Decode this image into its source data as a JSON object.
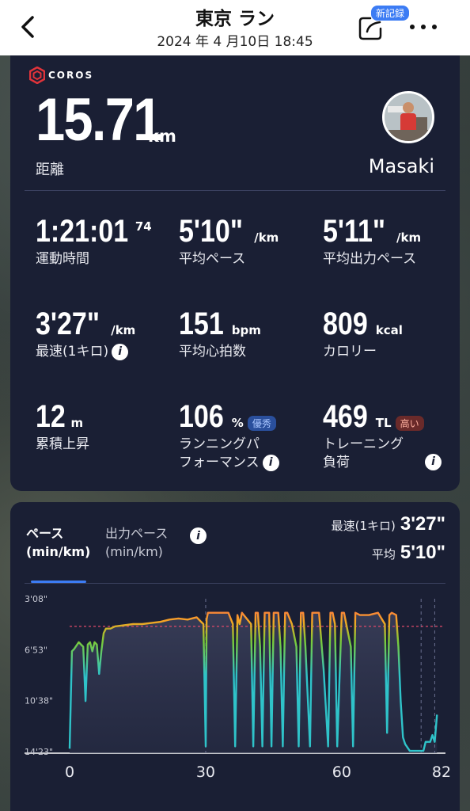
{
  "header": {
    "title": "東京 ラン",
    "datetime": "2024 年 4 月10日 18:45",
    "new_record_badge": "新記録"
  },
  "summary": {
    "brand": "COROS",
    "distance_value": "15.71",
    "distance_unit": "km",
    "distance_label": "距離",
    "user_name": "Masaki"
  },
  "stats": [
    {
      "value": "1:21:01",
      "suffix": "74",
      "unit": "",
      "label": "運動時間"
    },
    {
      "value": "5'10\"",
      "unit": "/km",
      "label": "平均ペース"
    },
    {
      "value": "5'11\"",
      "unit": "/km",
      "label": "平均出力ペース"
    },
    {
      "value": "3'27\"",
      "unit": "/km",
      "label": "最速(1キロ)"
    },
    {
      "value": "151",
      "unit": "bpm",
      "label": "平均心拍数"
    },
    {
      "value": "809",
      "unit": "kcal",
      "label": "カロリー"
    },
    {
      "value": "12",
      "unit": "m",
      "label": "累積上昇"
    },
    {
      "value": "106",
      "unit": "%",
      "badge": "優秀",
      "label": "ランニングパフォーマンス",
      "label_l1": "ランニングパ",
      "label_l2": "フォーマンス"
    },
    {
      "value": "469",
      "unit": "TL",
      "badge": "高い",
      "label_l1": "トレーニング",
      "label_l2": "負荷"
    }
  ],
  "chart_panel": {
    "tab_pace_l1": "ペース",
    "tab_pace_l2": "(min/km)",
    "tab_power_l1": "出力ペース",
    "tab_power_l2": "(min/km)",
    "fastest_label": "最速(1キロ)",
    "fastest_value": "3'27\"",
    "avg_label": "平均",
    "avg_value": "5'10\""
  },
  "colors": {
    "card_bg": "#1a1f34",
    "accent_blue": "#3c7cf4",
    "pace_slow": "#2fc3c9",
    "pace_mid": "#7acb3a",
    "pace_fast": "#ff5a55",
    "avg_line": "#e0486a"
  },
  "chart_data": {
    "type": "line",
    "title": "",
    "xlabel": "",
    "ylabel": "",
    "y_tick_labels": [
      "3'08\"",
      "6'53\"",
      "10'38\"",
      "14'23\""
    ],
    "y_ticks_sec": [
      188,
      413,
      638,
      863
    ],
    "x_tick_labels": [
      "0",
      "30",
      "60",
      "82"
    ],
    "x_ticks": [
      0,
      30,
      60,
      82
    ],
    "xlim": [
      0,
      82
    ],
    "ylim_sec": [
      188,
      863
    ],
    "y_inverted": true,
    "avg_line_sec": 310,
    "vertical_markers_x": [
      30,
      77.5,
      80.5
    ],
    "x": [
      0,
      0.5,
      1,
      2,
      3,
      3.5,
      4,
      4.5,
      5,
      5.5,
      6,
      6.5,
      7,
      7.5,
      8,
      9,
      10,
      12,
      14,
      16,
      18,
      20,
      22,
      24,
      26,
      28,
      29.5,
      30,
      30.2,
      30.5,
      31,
      33,
      35,
      36,
      36.5,
      37,
      37.5,
      38,
      40,
      40.5,
      41,
      41.5,
      42,
      42.5,
      43,
      44,
      44.5,
      45,
      46,
      46.5,
      47,
      47.5,
      48,
      49,
      50,
      50.5,
      51,
      51.5,
      52,
      53,
      53.5,
      54,
      55,
      56,
      57,
      57.5,
      58,
      58.5,
      59,
      60,
      60.5,
      61,
      62,
      62.5,
      63,
      64,
      66,
      68,
      69.5,
      70,
      70.5,
      71,
      72,
      72.5,
      73,
      73.5,
      74,
      75,
      76,
      76.5,
      77,
      77.5,
      78,
      78.5,
      79.5,
      80,
      80.5,
      81
    ],
    "y_sec": [
      850,
      420,
      410,
      380,
      400,
      640,
      390,
      380,
      420,
      380,
      390,
      520,
      420,
      340,
      320,
      320,
      310,
      305,
      300,
      300,
      295,
      290,
      280,
      275,
      280,
      270,
      300,
      840,
      280,
      250,
      250,
      250,
      250,
      300,
      840,
      260,
      300,
      250,
      300,
      840,
      250,
      250,
      400,
      840,
      250,
      250,
      840,
      250,
      250,
      400,
      840,
      250,
      250,
      300,
      400,
      840,
      250,
      250,
      400,
      840,
      250,
      250,
      250,
      500,
      840,
      250,
      250,
      300,
      840,
      250,
      250,
      300,
      400,
      840,
      250,
      260,
      260,
      250,
      300,
      780,
      260,
      250,
      260,
      400,
      640,
      800,
      830,
      860,
      860,
      860,
      860,
      860,
      860,
      820,
      820,
      790,
      820,
      700
    ]
  }
}
